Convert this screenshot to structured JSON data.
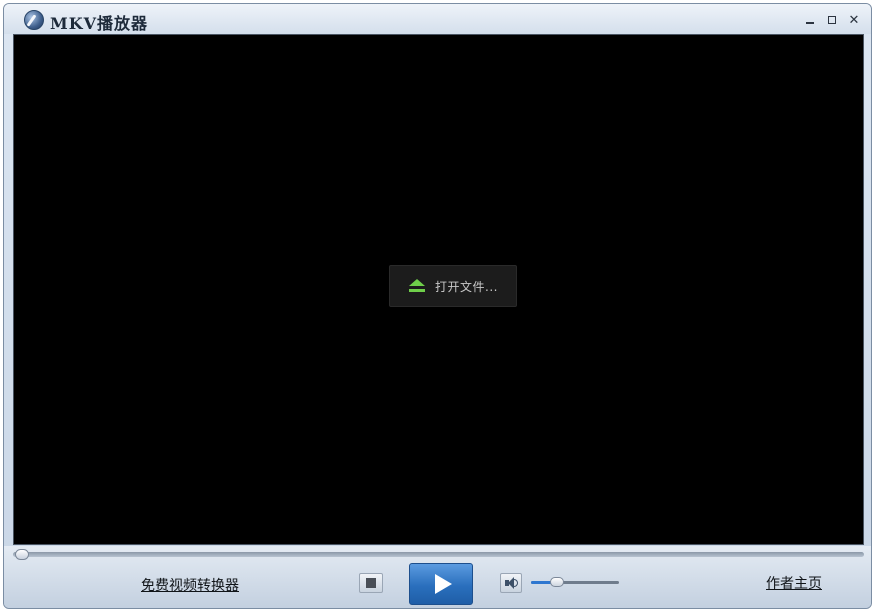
{
  "window": {
    "title": "MKV播放器",
    "icons": {
      "app": "app-logo-icon",
      "minimize": "minimize-icon",
      "maximize": "maximize-icon",
      "close": "close-icon"
    },
    "close_glyph": "✕"
  },
  "video": {
    "open_file_label": "打开文件...",
    "open_file_icon": "eject-icon",
    "background": "#000000",
    "accent": "#6fcf4a"
  },
  "controls": {
    "seek_progress": 0,
    "converter_link": "免费视频转换器",
    "author_link": "作者主页",
    "volume_level": 0.3,
    "icons": {
      "stop": "stop-icon",
      "play": "play-icon",
      "volume": "volume-icon"
    },
    "play_color": "#2a6fbd"
  }
}
